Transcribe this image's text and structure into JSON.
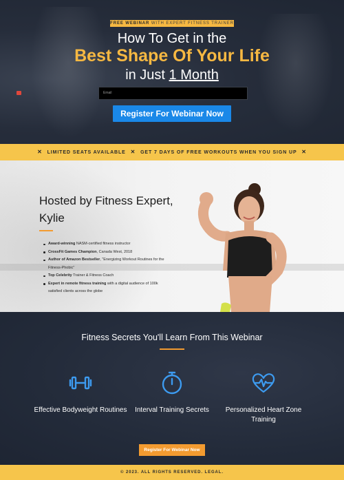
{
  "hero": {
    "badge_bold": "FREE WEBINAR",
    "badge_rest": "WITH EXPERT FITNESS TRAINER",
    "title_line1": "How To Get in the",
    "title_line2": "Best Shape Of Your Life",
    "title_line3_prefix": "in Just ",
    "title_line3_underlined": "1 Month",
    "email_placeholder": "Email",
    "register_button": "Register For Webinar Now"
  },
  "strip": {
    "item1": "LIMITED SEATS AVAILABLE",
    "item2": "GET 7 DAYS OF FREE WORKOUTS WHEN YOU SIGN UP",
    "separator": "✕"
  },
  "hosted": {
    "title": "Hosted by Fitness Expert, Kylie",
    "bullets": [
      {
        "bold": "Award-winning",
        "rest": " NASM-certified fitness instructor"
      },
      {
        "bold": "CrossFit Games Champion",
        "rest": ", Canada West, 2018"
      },
      {
        "bold": "Author of Amazon Bestseller",
        "rest": ", \"Energizing Workout Routines for the Fitness-Phobic\""
      },
      {
        "bold": "Top Celebrity",
        "rest": " Trainer & Fitness Coach"
      },
      {
        "bold": "Expert in remote fitness training",
        "rest": " with a digital audience of 100k satisfied clients across the globe"
      }
    ]
  },
  "secrets": {
    "title": "Fitness Secrets You'll Learn From This Webinar",
    "features": [
      {
        "icon": "dumbbell-icon",
        "label": "Effective Bodyweight Routines"
      },
      {
        "icon": "stopwatch-icon",
        "label": "Interval Training Secrets"
      },
      {
        "icon": "heart-pulse-icon",
        "label": "Personalized Heart Zone Training"
      }
    ],
    "cta_button": "Register For Webinar Now"
  },
  "footer": {
    "text": "© 2023. ALL RIGHTS RESERVED. LEGAL."
  },
  "colors": {
    "accent_yellow": "#f6c54b",
    "accent_orange": "#f39b30",
    "button_blue": "#1a88e8",
    "dark_bg": "#232b3a"
  }
}
